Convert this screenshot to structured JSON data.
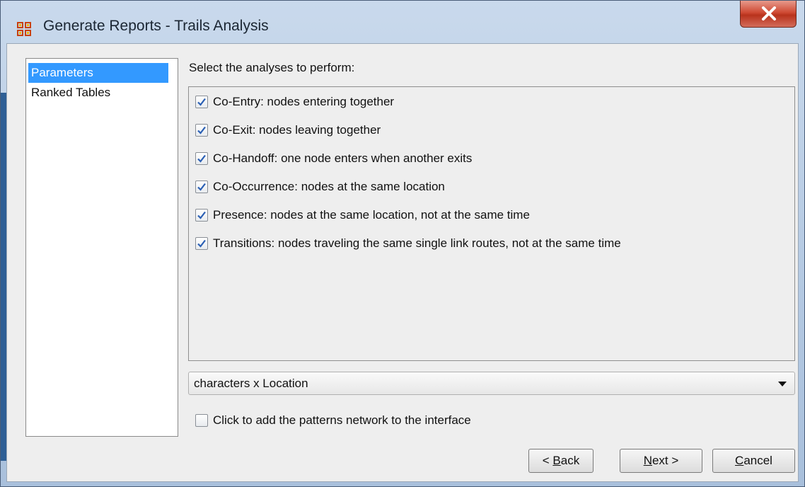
{
  "window": {
    "title": "Generate Reports - Trails Analysis"
  },
  "icons": {
    "app": "network-grid-icon",
    "close": "close-icon",
    "checkmark": "checkmark-icon",
    "dropdown": "triangle-down-icon"
  },
  "colors": {
    "selection": "#3399ff",
    "close_button": "#c8412b",
    "client_bg": "#eeeeee"
  },
  "nav": {
    "items": [
      {
        "label": "Parameters",
        "selected": true
      },
      {
        "label": "Ranked Tables",
        "selected": false
      }
    ]
  },
  "main": {
    "section_label": "Select the analyses to perform:",
    "analyses": [
      {
        "label": "Co-Entry: nodes entering together",
        "checked": true
      },
      {
        "label": "Co-Exit: nodes leaving together",
        "checked": true
      },
      {
        "label": "Co-Handoff: one node enters when another exits",
        "checked": true
      },
      {
        "label": "Co-Occurrence: nodes at the same location",
        "checked": true
      },
      {
        "label": "Presence: nodes at the same location, not at the same time",
        "checked": true
      },
      {
        "label": "Transitions: nodes traveling the same single link routes, not at the same time",
        "checked": true
      }
    ],
    "network_select": {
      "value": "characters x Location"
    },
    "patterns_checkbox": {
      "label": "Click to add the patterns network to the interface",
      "checked": false
    }
  },
  "buttons": {
    "back": {
      "prefix": "< ",
      "mnemonic": "B",
      "rest": "ack"
    },
    "next": {
      "mnemonic": "N",
      "rest": "ext >"
    },
    "cancel": {
      "mnemonic": "C",
      "rest": "ancel"
    }
  }
}
